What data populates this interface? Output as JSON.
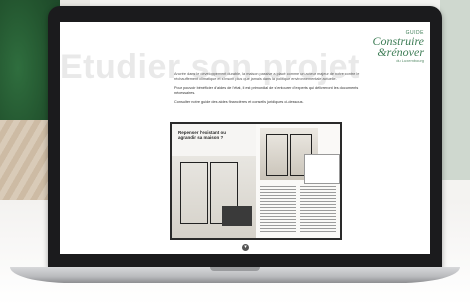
{
  "page": {
    "bg_title": "Etudier son projet",
    "logo": {
      "small": "GUIDE",
      "big_line1": "Construire",
      "big_line2": "&rénover",
      "sub": "du Luxembourg"
    },
    "text": {
      "p1": "Ancrée dans le développement durable, la maison passive a placé comme un acteur majeur de notre contre le réchauffement climatique et s’inscrit plus que jamais dans la politique environnementale actuelle.",
      "p2": "Pour pouvoir bénéficier d’aides de l’état, il est primordial de s’entourer d’experts qui délivreront les documents nécessaires.",
      "p3": "Consulter notre guide des aides financières et conseils juridiques ci-dessous."
    },
    "magazine": {
      "headline": "Repenser l’existant ou agrandir sa maison ?"
    }
  }
}
